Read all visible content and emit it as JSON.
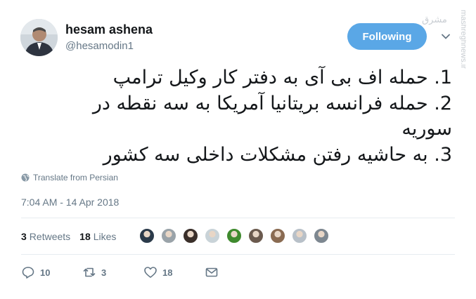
{
  "author": {
    "display_name": "hesam ashena",
    "handle": "@hesamodin1",
    "avatar_icon": "profile-photo"
  },
  "follow_button": {
    "label": "Following",
    "color": "#5aa7e6"
  },
  "tweet": {
    "lines": [
      "1. حمله اف بی آی به دفتر کار وکیل ترامپ",
      "2. حمله فرانسه بریتانیا آمریکا  به سه نقطه در",
      "سوریه",
      "3. به حاشیه رفتن مشکلات داخلی سه کشور"
    ]
  },
  "translate_label": "Translate from Persian",
  "timestamp": "7:04 AM - 14 Apr 2018",
  "stats": {
    "retweets_count": "3",
    "retweets_label": "Retweets",
    "likes_count": "18",
    "likes_label": "Likes"
  },
  "likers": [
    {
      "name": "liker-1",
      "color": "#2b3a4a"
    },
    {
      "name": "liker-2",
      "color": "#9aa3a9"
    },
    {
      "name": "liker-3",
      "color": "#3a2f2a"
    },
    {
      "name": "liker-4",
      "color": "#c9d3d8"
    },
    {
      "name": "liker-5",
      "color": "#3f8a2e"
    },
    {
      "name": "liker-6",
      "color": "#6b5a4e"
    },
    {
      "name": "liker-7",
      "color": "#8a6b52"
    },
    {
      "name": "liker-8",
      "color": "#b8c0c8"
    },
    {
      "name": "liker-9",
      "color": "#7d8790"
    }
  ],
  "actions": {
    "reply_count": "10",
    "retweet_count": "3",
    "like_count": "18"
  },
  "colors": {
    "text": "#14171a",
    "secondary": "#657786",
    "divider": "#e6ecf0",
    "accent": "#5aa7e6"
  },
  "watermark": {
    "logo_text": "مشرق",
    "site_text": "mashreghnews.ir"
  }
}
